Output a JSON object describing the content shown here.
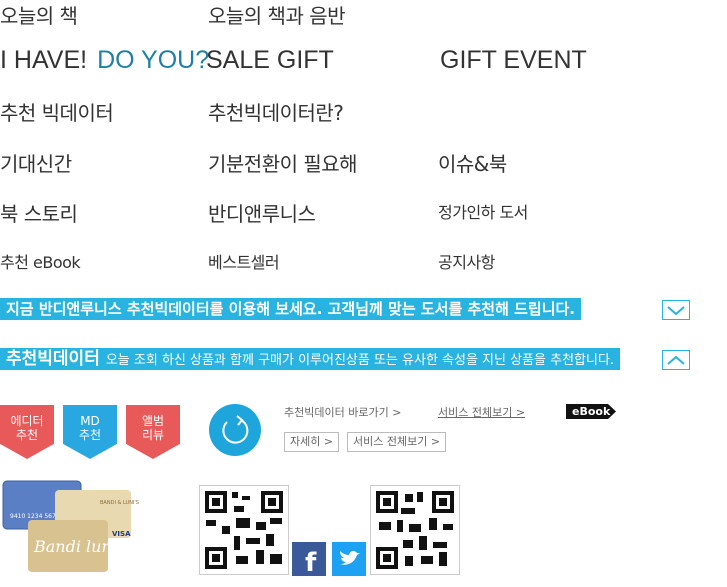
{
  "menu": {
    "row1": [
      "오늘의 책",
      "오늘의 책과 음반"
    ],
    "row2": {
      "a": "I HAVE!",
      "b": "DO YOU?",
      "c": "SALE GIFT",
      "d": "GIFT EVENT"
    },
    "row3": [
      "추천 빅데이터",
      "추천빅데이터란?"
    ],
    "row4": [
      "기대신간",
      "기분전환이 필요해",
      "이슈&북"
    ],
    "row5": [
      "북 스토리",
      "반디앤루니스",
      "정가인하 도서"
    ],
    "row6": [
      "추천 eBook",
      "베스트셀러",
      "공지사항"
    ]
  },
  "banner1": {
    "text": "지금 반디앤루니스 추천빅데이터를 이용해 보세요. 고객님께 맞는 도서를 추천해 드립니다."
  },
  "banner2": {
    "head": "추천빅데이터",
    "desc": "오늘 조회 하신 상품과 함께 구매가 이루어진상품 또는 유사한 속성을 지닌 상품을 추천합니다."
  },
  "badges": [
    {
      "label": "에디터\n추천",
      "color": "#e85a5a"
    },
    {
      "label": "MD\n추천",
      "color": "#29a7e1"
    },
    {
      "label": "앨범\n리뷰",
      "color": "#e85a5a"
    }
  ],
  "links": {
    "shortcut": "추천빅데이터 바로가기 >",
    "all_services": "서비스 전체보기 >",
    "ebook": "eBook",
    "detail": "자세히 >",
    "all_services_box": "서비스 전체보기 >"
  },
  "colors": {
    "accent": "#29b3e0",
    "accent_dark": "#1e7fa8",
    "red": "#e85a5a",
    "facebook": "#3b5998",
    "twitter": "#1da1f2"
  },
  "card_text": {
    "card1_number": "9410 1234 5678",
    "card1_brand": "VISA",
    "card2_brand": "BANDI & LUNI'S",
    "card3_script": "Bandi luni's"
  },
  "social": {
    "facebook": "f"
  }
}
